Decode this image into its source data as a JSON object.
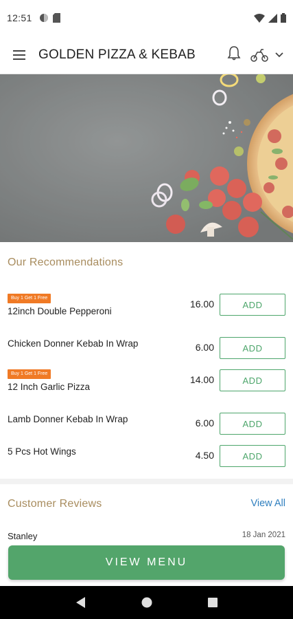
{
  "status_bar": {
    "time": "12:51"
  },
  "app_bar": {
    "title": "GOLDEN PIZZA & KEBAB"
  },
  "recommendations": {
    "title": "Our Recommendations",
    "items": [
      {
        "badge": "Buy 1 Get 1 Free",
        "name": "12inch Double Pepperoni",
        "price": "16.00",
        "add_label": "ADD"
      },
      {
        "badge": "",
        "name": "Chicken Donner Kebab In Wrap",
        "price": "6.00",
        "add_label": "ADD"
      },
      {
        "badge": "Buy 1 Get 1 Free",
        "name": "12 Inch Garlic Pizza",
        "price": "14.00",
        "add_label": "ADD"
      },
      {
        "badge": "",
        "name": "Lamb Donner Kebab In Wrap",
        "price": "6.00",
        "add_label": "ADD"
      },
      {
        "badge": "",
        "name": "5 Pcs Hot Wings",
        "price": "4.50",
        "add_label": "ADD"
      }
    ]
  },
  "reviews": {
    "title": "Customer Reviews",
    "view_all": "View All",
    "first_reviewer": "Stanley",
    "first_date": "18 Jan 2021"
  },
  "footer": {
    "view_menu": "VIEW MENU"
  },
  "colors": {
    "accent_green": "#53a56b",
    "badge_orange": "#f07a25",
    "section_title": "#a88c5e",
    "link_blue": "#2f7fbf"
  },
  "icons": [
    "menu-icon",
    "bell-icon",
    "scooter-icon",
    "chevron-down-icon",
    "wifi-icon",
    "signal-icon",
    "battery-icon",
    "back-icon",
    "home-icon",
    "recents-icon"
  ]
}
